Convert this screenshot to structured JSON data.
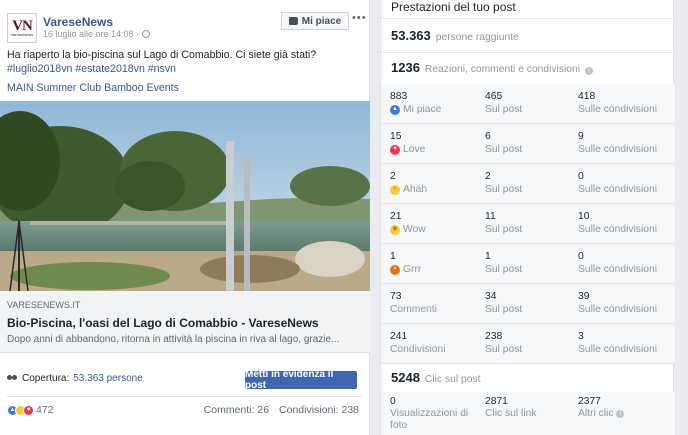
{
  "post": {
    "page_name": "VareseNews",
    "logo_text": "VN",
    "logo_sub": "VareseNews",
    "date": "16 luglio alle ore 14:08 ·",
    "like_page_label": "Mi piace",
    "more_label": "•••",
    "text": "Ha riaperto la bio-piscina sul Lago di Comabbio. Ci siete già stati?",
    "hashtags": "#luglio2018vn #estate2018vn #nsvn",
    "link_text": "MAIN Summer Club Bamboo Events",
    "link_preview": {
      "domain": "VARESENEWS.IT",
      "title": "Bio-Piscina, l'oasi del Lago di Comabbio - VareseNews",
      "description": "Dopo anni di abbandono, ritorna in attività la piscina in riva al lago, grazie..."
    },
    "coverage_label": "Copertura:",
    "coverage_value": "53.363 persone",
    "boost_label": "Metti in evidenza il post",
    "reactions_count": "472",
    "comments": "Commenti: 26",
    "shares": "Condivisioni: 238"
  },
  "insights": {
    "title": "Prestazioni del tuo post",
    "reach_number": "53.363",
    "reach_label": "persone raggiunte",
    "interactions_number": "1236",
    "interactions_label": "Reazioni, commenti e condivisioni",
    "rows": [
      {
        "c1_num": "883",
        "c1_lbl": "Mi piace",
        "icon": "like",
        "c2_num": "465",
        "c2_lbl": "Sul post",
        "c3_num": "418",
        "c3_lbl": "Sulle condivisioni"
      },
      {
        "c1_num": "15",
        "c1_lbl": "Love",
        "icon": "love",
        "c2_num": "6",
        "c2_lbl": "Sul post",
        "c3_num": "9",
        "c3_lbl": "Sulle condivisioni"
      },
      {
        "c1_num": "2",
        "c1_lbl": "Ahah",
        "icon": "haha",
        "c2_num": "2",
        "c2_lbl": "Sul post",
        "c3_num": "0",
        "c3_lbl": "Sulle condivisioni"
      },
      {
        "c1_num": "21",
        "c1_lbl": "Wow",
        "icon": "wow",
        "c2_num": "11",
        "c2_lbl": "Sul post",
        "c3_num": "10",
        "c3_lbl": "Sulle condivisioni"
      },
      {
        "c1_num": "1",
        "c1_lbl": "Grrr",
        "icon": "grrr",
        "c2_num": "1",
        "c2_lbl": "Sul post",
        "c3_num": "0",
        "c3_lbl": "Sulle condivisioni"
      },
      {
        "c1_num": "73",
        "c1_lbl": "Commenti",
        "icon": "",
        "c2_num": "34",
        "c2_lbl": "Sul post",
        "c3_num": "39",
        "c3_lbl": "Sulle condivisioni"
      },
      {
        "c1_num": "241",
        "c1_lbl": "Condivisioni",
        "icon": "",
        "c2_num": "238",
        "c2_lbl": "Sul post",
        "c3_num": "3",
        "c3_lbl": "Sulle condivisioni"
      }
    ],
    "clicks_number": "5248",
    "clicks_label": "Clic sul post",
    "clicks": [
      {
        "num": "0",
        "lbl": "Visualizzazioni di foto"
      },
      {
        "num": "2871",
        "lbl": "Clic sul link"
      },
      {
        "num": "2377",
        "lbl": "Altri clic"
      }
    ]
  }
}
